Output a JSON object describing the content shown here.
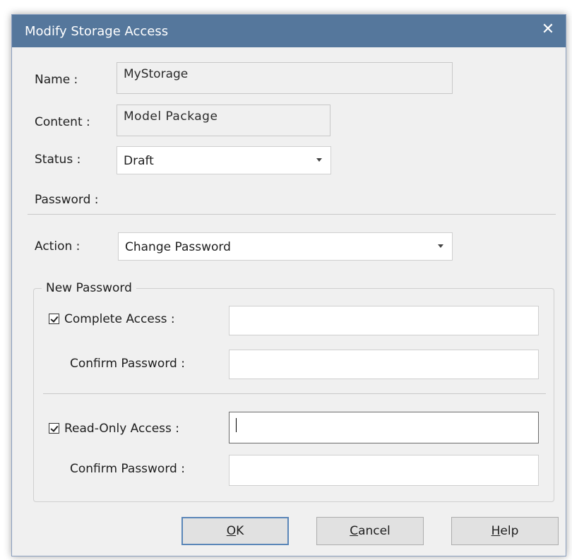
{
  "window": {
    "title": "Modify Storage Access",
    "close_glyph": "✕"
  },
  "fields": {
    "name_label": "Name :",
    "name_value": "MyStorage",
    "content_label": "Content :",
    "content_value": "Model Package",
    "status_label": "Status :",
    "status_value": "Draft",
    "password_label": "Password :",
    "action_label": "Action :",
    "action_value": "Change Password"
  },
  "new_password": {
    "group_title": "New Password",
    "complete_access": {
      "label": "Complete Access :",
      "checked": true,
      "value": ""
    },
    "complete_confirm": {
      "label": "Confirm Password :",
      "value": ""
    },
    "readonly_access": {
      "label": "Read-Only Access :",
      "checked": true,
      "value": ""
    },
    "readonly_confirm": {
      "label": "Confirm Password :",
      "value": ""
    }
  },
  "buttons": {
    "ok": {
      "mnemonic": "O",
      "rest": "K"
    },
    "cancel": {
      "mnemonic": "C",
      "rest": "ancel"
    },
    "help": {
      "mnemonic": "H",
      "rest": "elp"
    }
  },
  "icons": [
    "close-icon",
    "dropdown-arrow-icon",
    "checkbox-checked-icon"
  ],
  "colors": {
    "titlebar": "#55779c",
    "dialog_bg": "#f0f0f0",
    "default_button_border": "#5a86b8"
  }
}
